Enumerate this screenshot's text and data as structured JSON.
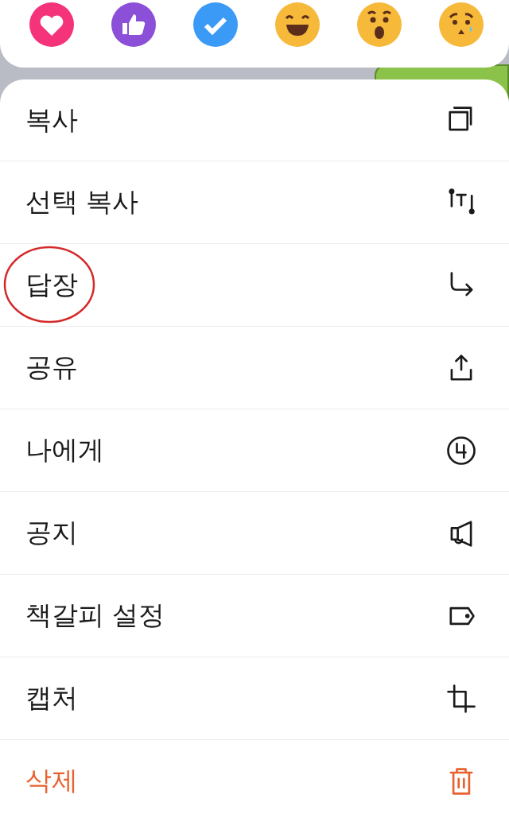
{
  "menu": {
    "items": [
      {
        "label": "복사",
        "kind": "normal",
        "circled": false
      },
      {
        "label": "선택 복사",
        "kind": "normal",
        "circled": false
      },
      {
        "label": "답장",
        "kind": "normal",
        "circled": true
      },
      {
        "label": "공유",
        "kind": "normal",
        "circled": false
      },
      {
        "label": "나에게",
        "kind": "normal",
        "circled": false
      },
      {
        "label": "공지",
        "kind": "normal",
        "circled": false
      },
      {
        "label": "책갈피 설정",
        "kind": "normal",
        "circled": false
      },
      {
        "label": "캡처",
        "kind": "normal",
        "circled": false
      },
      {
        "label": "삭제",
        "kind": "danger",
        "circled": false
      }
    ]
  }
}
